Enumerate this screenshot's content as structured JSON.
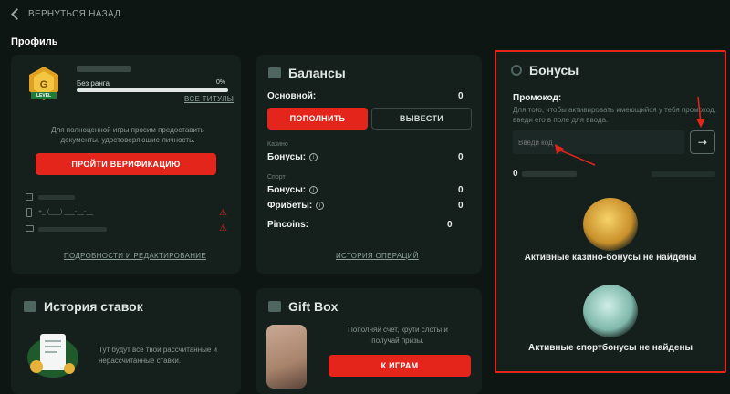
{
  "nav": {
    "back_label": "ВЕРНУТЬСЯ НАЗАД"
  },
  "page_title": "Профиль",
  "profile": {
    "badge_text": "LEVEL",
    "rank_label": "Без ранга",
    "progress_text": "0%",
    "progress_value": 0,
    "all_titles_link": "ВСЕ ТИТУЛЫ",
    "verify_note": "Для полноценной игры просим предоставить документы, удостоверяющие личность.",
    "verify_button": "ПРОЙТИ ВЕРИФИКАЦИЮ",
    "phone_value": "+_ (___) ___-__-__",
    "details_link": "ПОДРОБНОСТИ И РЕДАКТИРОВАНИЕ"
  },
  "balances": {
    "title": "Балансы",
    "main_label": "Основной:",
    "main_value": "0",
    "deposit_button": "ПОПОЛНИТЬ",
    "withdraw_button": "ВЫВЕСТИ",
    "casino_section": "Казино",
    "casino_bonuses_label": "Бонусы:",
    "casino_bonuses_value": "0",
    "sport_section": "Спорт",
    "sport_bonuses_label": "Бонусы:",
    "sport_bonuses_value": "0",
    "freebets_label": "Фрибеты:",
    "freebets_value": "0",
    "pincoins_label": "Pincoins:",
    "pincoins_value": "0",
    "history_link": "ИСТОРИЯ ОПЕРАЦИЙ"
  },
  "bonuses": {
    "title": "Бонусы",
    "promo_label": "Промокод:",
    "promo_hint": "Для того, чтобы активировать имеющийся у тебя промокод, введи его в поле для ввода.",
    "promo_placeholder": "Введи код",
    "points_value": "0",
    "casino_empty": "Активные казино-бонусы не найдены",
    "sport_empty": "Активные спортбонусы не найдены"
  },
  "bets_history": {
    "title": "История ставок",
    "text": "Тут будут все твои рассчитанные и нерассчитанные ставки."
  },
  "giftbox": {
    "title": "Gift Box",
    "text": "Пополняй счет, крути слоты и получай призы.",
    "button": "К ИГРАМ"
  },
  "colors": {
    "accent_red": "#e3251b",
    "card_bg": "#15201d",
    "page_bg": "#0e1614",
    "highlight_border": "#e3251b"
  }
}
